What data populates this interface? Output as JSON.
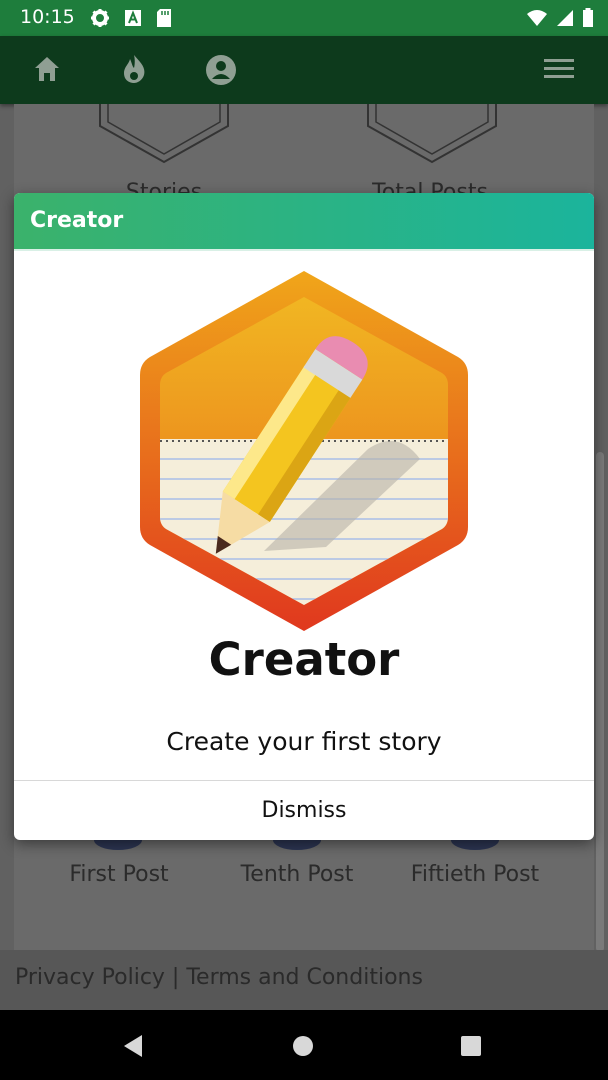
{
  "status_bar": {
    "time": "10:15"
  },
  "background": {
    "stat_labels": [
      "Stories",
      "Total Posts"
    ],
    "badge_labels": [
      "First Post",
      "Tenth Post",
      "Fiftieth Post"
    ],
    "footer": "Privacy Policy | Terms and Conditions"
  },
  "modal": {
    "header": "Creator",
    "badge_title": "Creator",
    "badge_description": "Create your first story",
    "dismiss_label": "Dismiss"
  },
  "icons": [
    "settings-icon",
    "font-icon",
    "sd-card-icon",
    "wifi-icon",
    "signal-icon",
    "battery-icon",
    "home-icon",
    "flame-icon",
    "account-icon",
    "menu-icon",
    "back-icon",
    "home-nav-icon",
    "recents-icon"
  ],
  "colors": {
    "status_bar": "#1e7d3c",
    "app_bar": "#0d3a1c",
    "header_gradient_start": "#3bb26b",
    "header_gradient_end": "#1bb49c",
    "badge_orange": "#f0a318",
    "badge_red": "#e0381e"
  }
}
